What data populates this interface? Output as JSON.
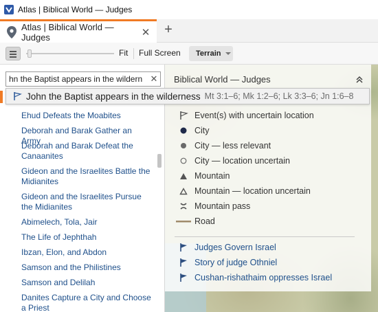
{
  "window": {
    "title": "Atlas | Biblical World — Judges"
  },
  "tab": {
    "label": "Atlas | Biblical World — Judges",
    "close": "✕",
    "new_tab": "+"
  },
  "toolbar": {
    "fit": "Fit",
    "full_screen": "Full Screen",
    "terrain": "Terrain"
  },
  "search": {
    "value": "hn the Baptist appears in the wildern",
    "clear": "✕"
  },
  "suggestion": {
    "title": "John the Baptist appears in the wilderness",
    "refs": "Mt 3:1–6; Mk 1:2–6; Lk 3:3–6; Jn 1:6–8"
  },
  "events": [
    "Ehud Defeats the Moabites",
    "Deborah and Barak Gather an Army",
    "Deborah and Barak Defeat the Canaanites",
    "Gideon and the Israelites Battle the Midianites",
    "Gideon and the Israelites Pursue the Midianites",
    "Abimelech, Tola, Jair",
    "The Life of Jephthah",
    "Ibzan, Elon, and Abdon",
    "Samson and the Philistines",
    "Samson and Delilah",
    "Danites Capture a City and Choose a Priest"
  ],
  "legend": {
    "title": "Biblical World — Judges",
    "items": [
      {
        "label": "Event(s) with uncertain location",
        "icon": "flag-outline-icon"
      },
      {
        "label": "City",
        "icon": "city-dot-icon"
      },
      {
        "label": "City — less relevant",
        "icon": "gray-dot-icon"
      },
      {
        "label": "City — location uncertain",
        "icon": "hollow-dot-icon"
      },
      {
        "label": "Mountain",
        "icon": "mountain-icon"
      },
      {
        "label": "Mountain — location uncertain",
        "icon": "hollow-mountain-icon"
      },
      {
        "label": "Mountain pass",
        "icon": "mountain-pass-icon"
      },
      {
        "label": "Road",
        "icon": "road-line-icon"
      }
    ],
    "map_events": [
      "Judges Govern Israel",
      "Story of judge Othniel",
      "Cushan-rishathaim oppresses Israel"
    ]
  },
  "colors": {
    "accent_orange": "#f07a24",
    "link_blue": "#1e4f8a",
    "city_navy": "#1f2a4a"
  }
}
